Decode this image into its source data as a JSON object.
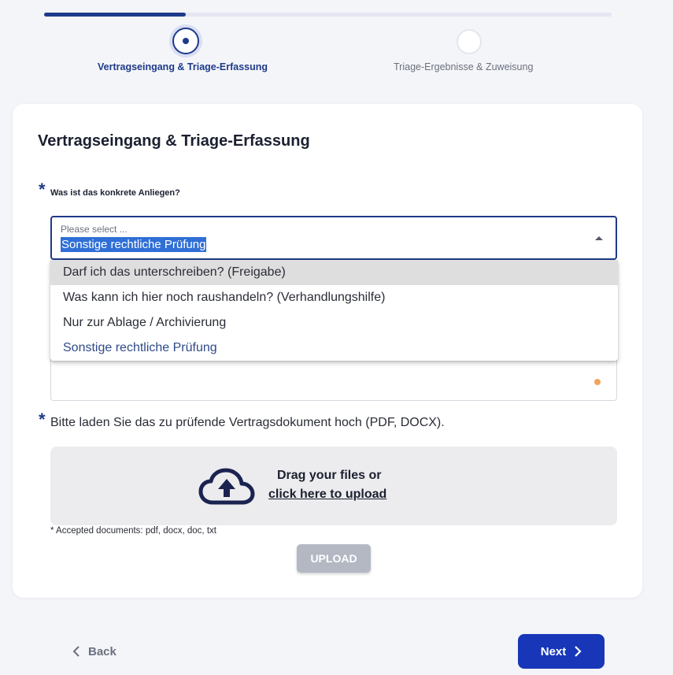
{
  "stepper": {
    "steps": [
      {
        "label": "Vertragseingang & Triage-Erfassung",
        "state": "active"
      },
      {
        "label": "Triage-Ergebnisse & Zuweisung",
        "state": "pending"
      }
    ],
    "progress_fraction": 0.25
  },
  "form": {
    "title": "Vertragseingang & Triage-Erfassung",
    "required_mark": "*",
    "question1": {
      "label": "Was ist das konkrete Anliegen?",
      "placeholder": "Please select ...",
      "value": "Sonstige rechtliche Prüfung",
      "options": [
        "Darf ich das unterschreiben? (Freigabe)",
        "Was kann ich hier noch raushandeln? (Verhandlungshilfe)",
        "Nur zur Ablage / Archivierung",
        "Sonstige rechtliche Prüfung"
      ]
    },
    "question2": {
      "label": "Bitte laden Sie das zu prüfende Vertragsdokument hoch (PDF, DOCX).",
      "drop_text": "Drag your files or",
      "click_text": "click here to upload",
      "accepted_note": "* Accepted documents: pdf, docx, doc, txt",
      "upload_label": "UPLOAD"
    }
  },
  "nav": {
    "back_label": "Back",
    "next_label": "Next"
  },
  "colors": {
    "accent": "#1e3a8a",
    "next_button": "#1737b8",
    "selection_highlight": "#2f6fd6"
  }
}
